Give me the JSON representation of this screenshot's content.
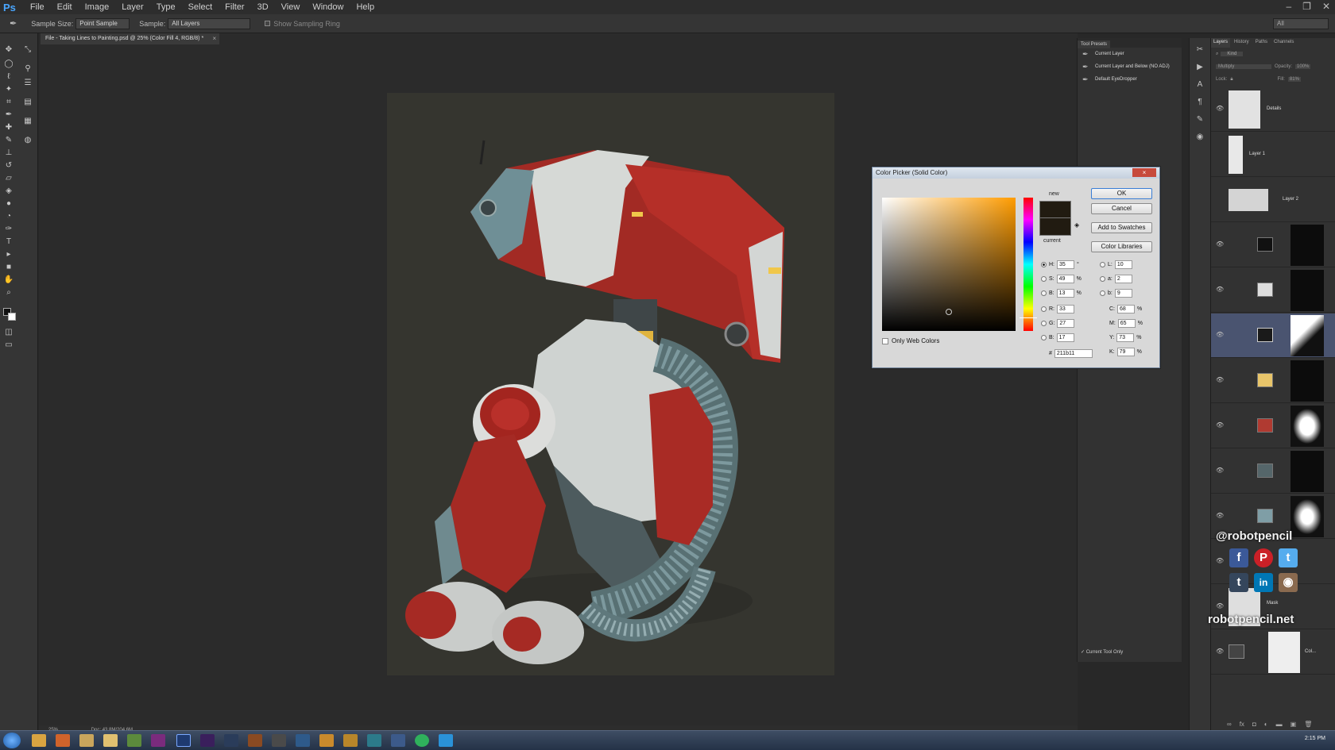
{
  "menubar": {
    "logo": "Ps",
    "items": [
      "File",
      "Edit",
      "Image",
      "Layer",
      "Type",
      "Select",
      "Filter",
      "3D",
      "View",
      "Window",
      "Help"
    ]
  },
  "options": {
    "sample_size_label": "Sample Size:",
    "sample_size_value": "Point Sample",
    "sample_label": "Sample:",
    "sample_value": "All Layers",
    "show_ring": "Show Sampling Ring",
    "right_field": "All"
  },
  "document": {
    "tab_title": "File - Taking Lines to Painting.psd @ 25% (Color Fill 4, RGB/8) *",
    "close": "×"
  },
  "status": {
    "zoom": "25%",
    "doc": "Doc: 43.8M/204.6M"
  },
  "tool_presets": {
    "tab": "Tool Presets",
    "items": [
      "Current Layer",
      "Current Layer and Below (NO ADJ)",
      "Default EyeDropper"
    ],
    "current_tool_only": "Current Tool Only"
  },
  "layers_panel": {
    "tabs": [
      "Layers",
      "History",
      "Paths",
      "Channels"
    ],
    "kind": "Kind",
    "blend": "Multiply",
    "opacity_label": "Opacity:",
    "opacity": "100%",
    "lock_label": "Lock:",
    "fill_label": "Fill:",
    "fill": "81%",
    "layers": [
      {
        "name": "Details"
      },
      {
        "name": "Layer 1"
      },
      {
        "name": "Layer 2"
      },
      {
        "name": "",
        "swatch": "#111111"
      },
      {
        "name": "",
        "swatch": "#dddddd"
      },
      {
        "name": "",
        "swatch": "#1a1a1a"
      },
      {
        "name": "",
        "swatch": "#e8c56a"
      },
      {
        "name": "",
        "swatch": "#b03a31"
      },
      {
        "name": "",
        "swatch": "#55666a"
      },
      {
        "name": "",
        "swatch": "#7f9ea6"
      },
      {
        "name": ""
      },
      {
        "name": "Mask"
      },
      {
        "name": "Col..."
      }
    ]
  },
  "color_picker": {
    "title": "Color Picker (Solid Color)",
    "close": "×",
    "new_label": "new",
    "current_label": "current",
    "ok": "OK",
    "cancel": "Cancel",
    "add_swatches": "Add to Swatches",
    "color_libraries": "Color Libraries",
    "only_web": "Only Web Colors",
    "H": "35",
    "S": "49",
    "B": "13",
    "R": "33",
    "G": "27",
    "Bv": "17",
    "L": "10",
    "a": "2",
    "b": "9",
    "C": "68",
    "M": "65",
    "Y": "73",
    "K": "79",
    "hex": "211b11",
    "hue_marker_fraction": 0.9,
    "color": "#211b11"
  },
  "watermark": {
    "handle": "@robotpencil",
    "site": "robotpencil.net",
    "social": [
      "f",
      "P",
      "t",
      "t",
      "in",
      "◉"
    ]
  },
  "taskbar": {
    "clock": "2:15 PM"
  }
}
